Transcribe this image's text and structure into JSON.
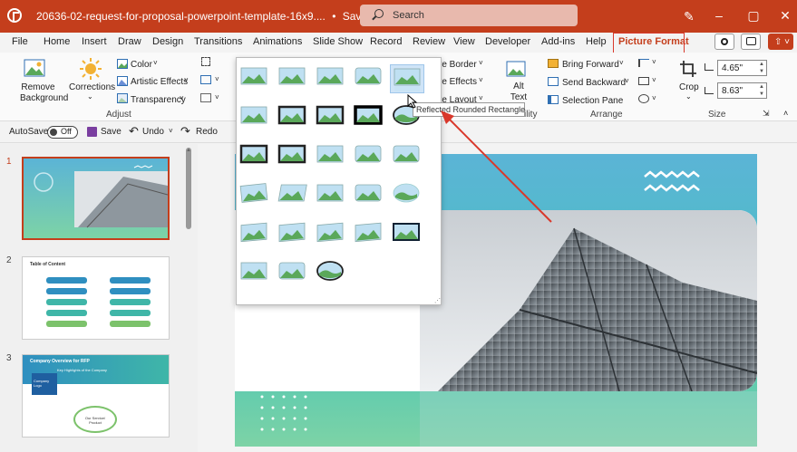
{
  "title_bar": {
    "doc_title": "20636-02-request-for-proposal-powerpoint-template-16x9....",
    "saved_status": "Saved to this PC",
    "saved_chevron": "⌄",
    "search_placeholder": "Search"
  },
  "menu": {
    "tabs": [
      "File",
      "Home",
      "Insert",
      "Draw",
      "Design",
      "Transitions",
      "Animations",
      "Slide Show",
      "Record",
      "Review",
      "View",
      "Developer",
      "Add-ins",
      "Help",
      "Picture Format"
    ],
    "active_tab": "Picture Format"
  },
  "ribbon": {
    "remove_background": "Remove Background",
    "corrections": "Corrections",
    "color": "Color",
    "artistic_effects": "Artistic Effects",
    "transparency": "Transparency",
    "adjust_label": "Adjust",
    "picture_border": "re Border",
    "picture_effects": "re Effects",
    "picture_layout": "re Layout",
    "alt_text": "Alt Text",
    "accessibility_label": "ility",
    "bring_forward": "Bring Forward",
    "send_backward": "Send Backward",
    "selection_pane": "Selection Pane",
    "arrange_label": "Arrange",
    "crop": "Crop",
    "height_value": "4.65\"",
    "width_value": "8.63\"",
    "size_label": "Size"
  },
  "qat": {
    "autosave": "AutoSave",
    "toggle": "Off",
    "save": "Save",
    "undo": "Undo",
    "redo": "Redo"
  },
  "slides": {
    "numbers": [
      "1",
      "2",
      "3"
    ],
    "slide2_title": "Table of Content",
    "slide3_title": "Company Overview for RFP",
    "slide3_subtitle": "Key Highlights of the Company",
    "slide3_logo": "Company Logo",
    "slide3_service": "Our Service/ Product"
  },
  "gallery": {
    "tooltip": "Reflected Rounded Rectangle",
    "style_count": 28,
    "highlighted_style": "Reflected Rounded Rectangle"
  },
  "colors": {
    "accent": "#c43e1c",
    "annotation": "#d9382b",
    "slide_gradient_top": "#5bb4d6",
    "slide_gradient_bottom": "#7dd3a6"
  }
}
